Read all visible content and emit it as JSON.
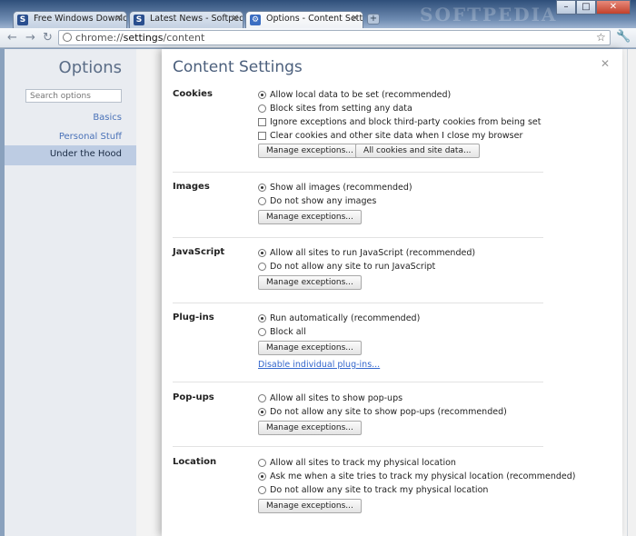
{
  "window": {
    "watermark": "SOFTPEDIA",
    "tabs": [
      {
        "title": "Free Windows Download..."
      },
      {
        "title": "Latest News - Softpedia"
      },
      {
        "title": "Options - Content Settings"
      }
    ]
  },
  "toolbar": {
    "url_scheme": "chrome://",
    "url_host": "settings",
    "url_path": "/content"
  },
  "sidebar": {
    "title": "Options",
    "search_placeholder": "Search options",
    "items": [
      {
        "label": "Basics"
      },
      {
        "label": "Personal Stuff"
      },
      {
        "label": "Under the Hood"
      }
    ]
  },
  "dialog": {
    "title": "Content Settings",
    "sections": {
      "cookies": {
        "title": "Cookies",
        "options": [
          "Allow local data to be set (recommended)",
          "Block sites from setting any data",
          "Ignore exceptions and block third-party cookies from being set",
          "Clear cookies and other site data when I close my browser"
        ],
        "btn_exceptions": "Manage exceptions...",
        "btn_all_cookies": "All cookies and site data..."
      },
      "images": {
        "title": "Images",
        "options": [
          "Show all images (recommended)",
          "Do not show any images"
        ],
        "btn_exceptions": "Manage exceptions..."
      },
      "javascript": {
        "title": "JavaScript",
        "options": [
          "Allow all sites to run JavaScript (recommended)",
          "Do not allow any site to run JavaScript"
        ],
        "btn_exceptions": "Manage exceptions..."
      },
      "plugins": {
        "title": "Plug-ins",
        "options": [
          "Run automatically (recommended)",
          "Block all"
        ],
        "btn_exceptions": "Manage exceptions...",
        "link": "Disable individual plug-ins..."
      },
      "popups": {
        "title": "Pop-ups",
        "options": [
          "Allow all sites to show pop-ups",
          "Do not allow any site to show pop-ups (recommended)"
        ],
        "btn_exceptions": "Manage exceptions..."
      },
      "location": {
        "title": "Location",
        "options": [
          "Allow all sites to track my physical location",
          "Ask me when a site tries to track my physical location (recommended)",
          "Do not allow any site to track my physical location"
        ],
        "btn_exceptions": "Manage exceptions..."
      }
    }
  }
}
